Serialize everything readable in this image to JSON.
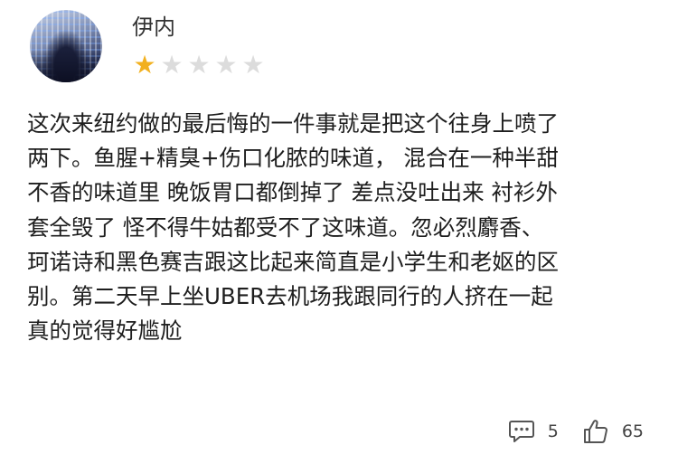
{
  "review": {
    "username": "伊内",
    "rating": {
      "value": 1,
      "max": 5
    },
    "colors": {
      "star_on": "#f2b01e",
      "star_off": "#dcdcdc"
    },
    "body": "这次来纽约做的最后悔的一件事就是把这个往身上喷了\n两下。鱼腥+精臭+伤口化脓的味道， 混合在一种半甜\n不香的味道里 晚饭胃口都倒掉了 差点没吐出来 衬衫外\n套全毁了 怪不得牛姑都受不了这味道。忽必烈麝香、\n珂诺诗和黑色赛吉跟这比起来简直是小学生和老妪的区\n别。第二天早上坐UBER去机场我跟同行的人挤在一起\n真的觉得好尴尬",
    "actions": {
      "comment_icon": "comment-icon",
      "comment_count": "5",
      "like_icon": "thumbs-up-icon",
      "like_count": "65"
    }
  }
}
